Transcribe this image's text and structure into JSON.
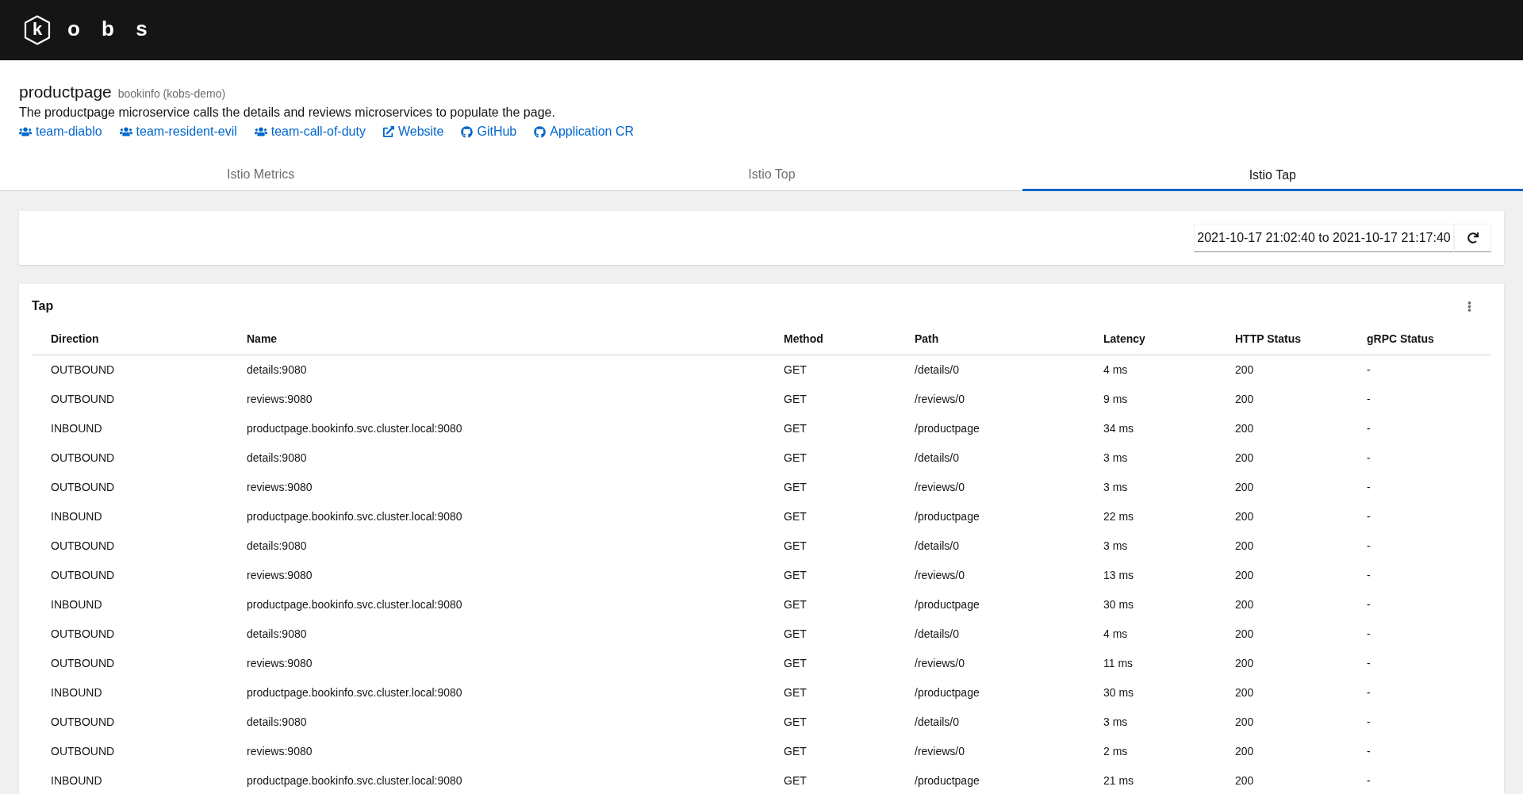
{
  "header": {
    "logo_mark": "k",
    "logo_text": "o b s"
  },
  "application": {
    "name": "productpage",
    "namespace": "bookinfo (kobs-demo)",
    "description": "The productpage microservice calls the details and reviews microservices to populate the page.",
    "links": [
      {
        "kind": "team",
        "label": "team-diablo"
      },
      {
        "kind": "team",
        "label": "team-resident-evil"
      },
      {
        "kind": "team",
        "label": "team-call-of-duty"
      },
      {
        "kind": "external",
        "label": "Website"
      },
      {
        "kind": "github",
        "label": "GitHub"
      },
      {
        "kind": "github",
        "label": "Application CR"
      }
    ]
  },
  "tabs": [
    {
      "label": "Istio Metrics",
      "selected": false
    },
    {
      "label": "Istio Top",
      "selected": false
    },
    {
      "label": "Istio Tap",
      "selected": true
    }
  ],
  "time_range": {
    "value": "2021-10-17 21:02:40 to 2021-10-17 21:17:40"
  },
  "tap": {
    "title": "Tap",
    "table": {
      "columns": [
        "Direction",
        "Name",
        "Method",
        "Path",
        "Latency",
        "HTTP Status",
        "gRPC Status"
      ],
      "rows": [
        [
          "OUTBOUND",
          "details:9080",
          "GET",
          "/details/0",
          "4 ms",
          "200",
          "-"
        ],
        [
          "OUTBOUND",
          "reviews:9080",
          "GET",
          "/reviews/0",
          "9 ms",
          "200",
          "-"
        ],
        [
          "INBOUND",
          "productpage.bookinfo.svc.cluster.local:9080",
          "GET",
          "/productpage",
          "34 ms",
          "200",
          "-"
        ],
        [
          "OUTBOUND",
          "details:9080",
          "GET",
          "/details/0",
          "3 ms",
          "200",
          "-"
        ],
        [
          "OUTBOUND",
          "reviews:9080",
          "GET",
          "/reviews/0",
          "3 ms",
          "200",
          "-"
        ],
        [
          "INBOUND",
          "productpage.bookinfo.svc.cluster.local:9080",
          "GET",
          "/productpage",
          "22 ms",
          "200",
          "-"
        ],
        [
          "OUTBOUND",
          "details:9080",
          "GET",
          "/details/0",
          "3 ms",
          "200",
          "-"
        ],
        [
          "OUTBOUND",
          "reviews:9080",
          "GET",
          "/reviews/0",
          "13 ms",
          "200",
          "-"
        ],
        [
          "INBOUND",
          "productpage.bookinfo.svc.cluster.local:9080",
          "GET",
          "/productpage",
          "30 ms",
          "200",
          "-"
        ],
        [
          "OUTBOUND",
          "details:9080",
          "GET",
          "/details/0",
          "4 ms",
          "200",
          "-"
        ],
        [
          "OUTBOUND",
          "reviews:9080",
          "GET",
          "/reviews/0",
          "11 ms",
          "200",
          "-"
        ],
        [
          "INBOUND",
          "productpage.bookinfo.svc.cluster.local:9080",
          "GET",
          "/productpage",
          "30 ms",
          "200",
          "-"
        ],
        [
          "OUTBOUND",
          "details:9080",
          "GET",
          "/details/0",
          "3 ms",
          "200",
          "-"
        ],
        [
          "OUTBOUND",
          "reviews:9080",
          "GET",
          "/reviews/0",
          "2 ms",
          "200",
          "-"
        ],
        [
          "INBOUND",
          "productpage.bookinfo.svc.cluster.local:9080",
          "GET",
          "/productpage",
          "21 ms",
          "200",
          "-"
        ]
      ]
    }
  }
}
